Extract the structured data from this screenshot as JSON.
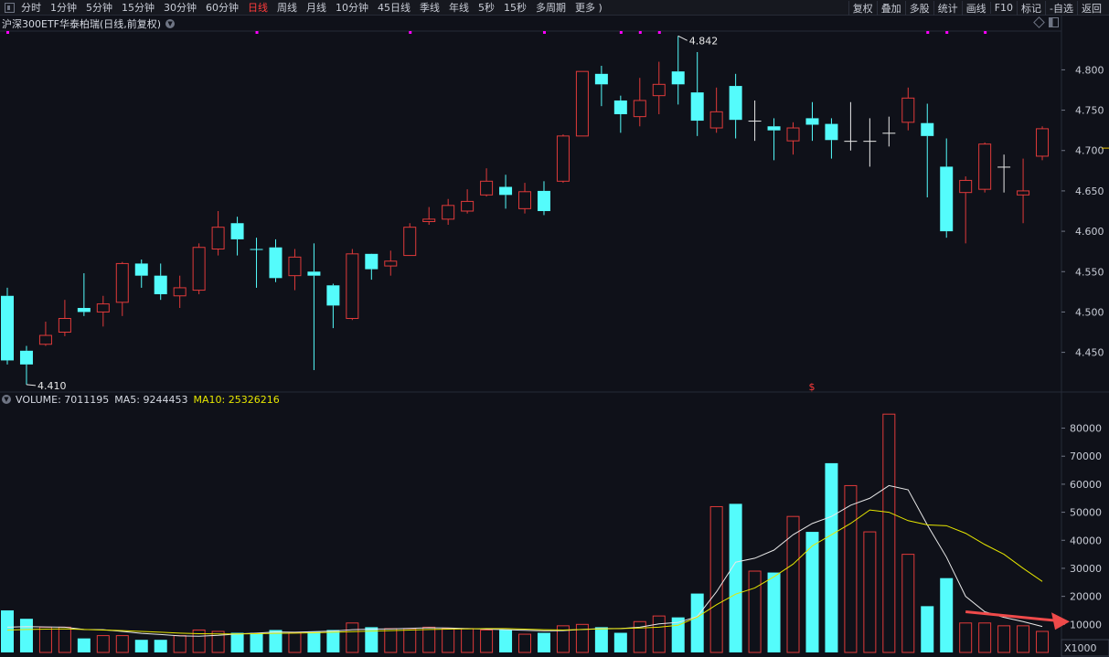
{
  "toolbar": {
    "left_items": [
      "分时",
      "1分钟",
      "5分钟",
      "15分钟",
      "30分钟",
      "60分钟",
      "日线",
      "周线",
      "月线",
      "10分钟",
      "45日线",
      "季线",
      "年线",
      "5秒",
      "15秒",
      "多周期",
      "更多 )"
    ],
    "active": "日线",
    "right_items": [
      "复权",
      "叠加",
      "多股",
      "统计",
      "画线",
      "F10",
      "标记",
      "-自选",
      "返回"
    ]
  },
  "chart_title": "沪深300ETF华泰柏瑞(日线,前复权)",
  "volume_legend": {
    "volume": "VOLUME: 7011195",
    "ma5": "MA5: 9244453",
    "ma10": "MA10: 25326216"
  },
  "colors": {
    "up": "#ff3b3b",
    "up_border": "#e03a3a",
    "down": "#54fcfc",
    "ma5": "#e8e8e8",
    "ma10": "#e6e600",
    "axis_text": "#c8ccd6",
    "grid": "#262a36",
    "marker": "#ff00ff",
    "arrow": "#ef4a4a"
  },
  "chart_data": {
    "type": "candlestick",
    "price_axis": {
      "ticks": [
        "4.800",
        "4.750",
        "4.700",
        "4.650",
        "4.600",
        "4.550",
        "4.500",
        "4.450"
      ],
      "range": [
        4.402,
        4.848
      ]
    },
    "volume_axis": {
      "ticks": [
        "80000",
        "70000",
        "60000",
        "50000",
        "40000",
        "30000",
        "20000",
        "10000"
      ],
      "unit": "X1000",
      "range": [
        0,
        88000
      ]
    },
    "annotations": {
      "high_label": "4.842",
      "low_label": "4.410",
      "high_index": 35,
      "low_index": 1
    },
    "special_marker": "$",
    "candles": [
      [
        4.52,
        4.44,
        4.53,
        4.435
      ],
      [
        4.452,
        4.435,
        4.458,
        4.41
      ],
      [
        4.46,
        4.471,
        4.488,
        4.458
      ],
      [
        4.475,
        4.492,
        4.515,
        4.47
      ],
      [
        4.505,
        4.5,
        4.548,
        4.495
      ],
      [
        4.5,
        4.51,
        4.52,
        4.482
      ],
      [
        4.512,
        4.56,
        4.562,
        4.495
      ],
      [
        4.56,
        4.545,
        4.565,
        4.53
      ],
      [
        4.545,
        4.522,
        4.56,
        4.515
      ],
      [
        4.52,
        4.53,
        4.545,
        4.505
      ],
      [
        4.527,
        4.58,
        4.585,
        4.522
      ],
      [
        4.578,
        4.605,
        4.625,
        4.57
      ],
      [
        4.61,
        4.59,
        4.618,
        4.57
      ],
      [
        4.578,
        4.577,
        4.592,
        4.53
      ],
      [
        4.58,
        4.542,
        4.59,
        4.537
      ],
      [
        4.545,
        4.568,
        4.578,
        4.527
      ],
      [
        4.55,
        4.545,
        4.585,
        4.428
      ],
      [
        4.533,
        4.508,
        4.535,
        4.48
      ],
      [
        4.492,
        4.572,
        4.578,
        4.49
      ],
      [
        4.572,
        4.553,
        4.57,
        4.54
      ],
      [
        4.557,
        4.563,
        4.576,
        4.545
      ],
      [
        4.57,
        4.605,
        4.61,
        4.57
      ],
      [
        4.612,
        4.615,
        4.63,
        4.608
      ],
      [
        4.615,
        4.632,
        4.64,
        4.608
      ],
      [
        4.625,
        4.637,
        4.652,
        4.622
      ],
      [
        4.645,
        4.662,
        4.678,
        4.643
      ],
      [
        4.655,
        4.645,
        4.67,
        4.628
      ],
      [
        4.628,
        4.649,
        4.66,
        4.622
      ],
      [
        4.65,
        4.625,
        4.662,
        4.62
      ],
      [
        4.662,
        4.718,
        4.72,
        4.66
      ],
      [
        4.718,
        4.798,
        4.798,
        4.718
      ],
      [
        4.795,
        4.782,
        4.805,
        4.755
      ],
      [
        4.762,
        4.745,
        4.768,
        4.722
      ],
      [
        4.742,
        4.762,
        4.79,
        4.73
      ],
      [
        4.768,
        4.782,
        4.81,
        4.745
      ],
      [
        4.798,
        4.782,
        4.842,
        4.757
      ],
      [
        4.772,
        4.737,
        4.822,
        4.718
      ],
      [
        4.728,
        4.748,
        4.778,
        4.722
      ],
      [
        4.78,
        4.738,
        4.795,
        4.715
      ],
      [
        4.737,
        4.737,
        4.762,
        4.712
      ],
      [
        4.73,
        4.725,
        4.74,
        4.688
      ],
      [
        4.712,
        4.728,
        4.735,
        4.695
      ],
      [
        4.74,
        4.732,
        4.76,
        4.712
      ],
      [
        4.733,
        4.713,
        4.74,
        4.69
      ],
      [
        4.712,
        4.712,
        4.76,
        4.7
      ],
      [
        4.712,
        4.712,
        4.74,
        4.68
      ],
      [
        4.722,
        4.722,
        4.742,
        4.705
      ],
      [
        4.735,
        4.765,
        4.778,
        4.725
      ],
      [
        4.734,
        4.718,
        4.758,
        4.642
      ],
      [
        4.68,
        4.6,
        4.715,
        4.592
      ],
      [
        4.648,
        4.663,
        4.668,
        4.585
      ],
      [
        4.652,
        4.708,
        4.71,
        4.648
      ],
      [
        4.68,
        4.68,
        4.695,
        4.648
      ],
      [
        4.645,
        4.65,
        4.69,
        4.61
      ],
      [
        4.693,
        4.727,
        4.73,
        4.688
      ]
    ],
    "volumes": [
      15000,
      12000,
      9000,
      9000,
      5000,
      6000,
      6000,
      4500,
      4500,
      6000,
      8000,
      7500,
      7000,
      7000,
      8000,
      7000,
      7500,
      8000,
      10500,
      9000,
      8500,
      8500,
      9000,
      8500,
      8500,
      8000,
      8000,
      6500,
      7000,
      9500,
      10000,
      9000,
      7000,
      11000,
      13000,
      12500,
      21000,
      52000,
      53000,
      29000,
      28500,
      48500,
      43000,
      67500,
      59500,
      43000,
      85000,
      35000,
      16500,
      26500,
      10500,
      10500,
      9500,
      9500,
      7500
    ],
    "ma5": [
      9000,
      9200,
      9100,
      9000,
      8200,
      8100,
      7500,
      6800,
      6400,
      5900,
      5800,
      6100,
      6600,
      6900,
      7300,
      7200,
      7400,
      7600,
      8100,
      8300,
      8400,
      8600,
      8800,
      8700,
      8500,
      8300,
      8100,
      7900,
      7700,
      7800,
      8200,
      8500,
      8500,
      9000,
      10200,
      10700,
      12800,
      21600,
      32200,
      33600,
      36500,
      42000,
      46000,
      48500,
      52500,
      55000,
      59500,
      58000,
      45500,
      34000,
      20000,
      14500,
      12500,
      11000,
      9244
    ],
    "ma10": [
      8000,
      8200,
      8300,
      8400,
      8200,
      8000,
      7800,
      7500,
      7200,
      6900,
      6700,
      6600,
      6600,
      6700,
      6800,
      6900,
      7000,
      7200,
      7400,
      7600,
      7800,
      8000,
      8200,
      8300,
      8400,
      8500,
      8500,
      8300,
      8100,
      8000,
      8200,
      8400,
      8500,
      8700,
      9000,
      9700,
      12600,
      17000,
      20800,
      23000,
      27000,
      31500,
      38000,
      42000,
      46000,
      50800,
      50000,
      47000,
      45500,
      45200,
      42500,
      38500,
      35000,
      30000,
      25326
    ],
    "magenta_markers": [
      0,
      13,
      21,
      28,
      32,
      33,
      34,
      48,
      49,
      51
    ]
  }
}
